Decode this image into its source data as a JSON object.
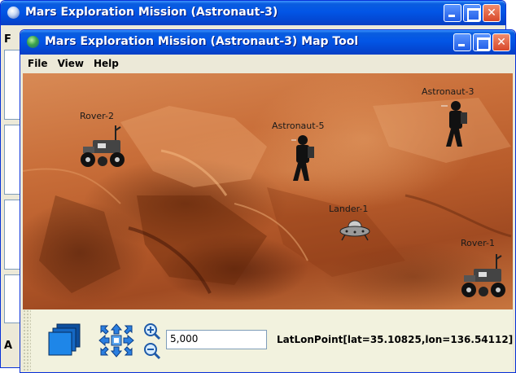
{
  "back_window": {
    "title": "Mars Exploration Mission (Astronaut-3)",
    "menu_first_letter": "F",
    "side_label": "A",
    "app_icon": "globe-icon"
  },
  "front_window": {
    "title": "Mars Exploration Mission (Astronaut-3) Map Tool",
    "app_icon": "globe-icon",
    "menu": [
      "File",
      "View",
      "Help"
    ]
  },
  "map": {
    "entities": [
      {
        "id": "rover-2",
        "label": "Rover-2",
        "type": "rover"
      },
      {
        "id": "astronaut-5",
        "label": "Astronaut-5",
        "type": "astronaut"
      },
      {
        "id": "astronaut-3",
        "label": "Astronaut-3",
        "type": "astronaut"
      },
      {
        "id": "lander-1",
        "label": "Lander-1",
        "type": "lander"
      },
      {
        "id": "rover-1",
        "label": "Rover-1",
        "type": "rover"
      }
    ]
  },
  "toolbar": {
    "layers_icon": "layers-icon",
    "pan_icon": "pan-arrows-icon",
    "zoom_in_icon": "zoom-in-icon",
    "zoom_out_icon": "zoom-out-icon",
    "zoom_value": "5,000",
    "coordinates": "LatLonPoint[lat=35.10825,lon=136.54112]"
  }
}
